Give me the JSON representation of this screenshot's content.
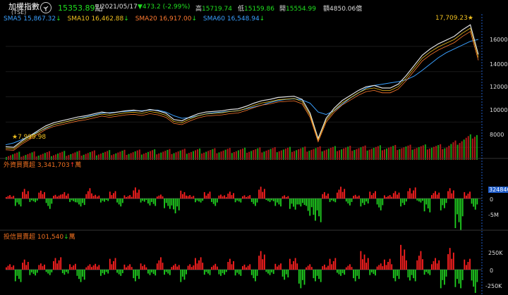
{
  "header": {
    "index_name": "加權指數",
    "index_code": "(TSE)",
    "price": "15353.89",
    "price_unit": "點",
    "date": "2021/05/17",
    "change": "473.2",
    "change_pct": "(-2.99%)",
    "high_label": "高",
    "high": "15719.74",
    "low_label": "低",
    "low": "15159.86",
    "open_label": "開",
    "open": "15554.99",
    "volume_label": "額",
    "volume": "4850.06億"
  },
  "ma_legend": [
    {
      "label": "SMA5",
      "value": "15,867.32",
      "dir": "↓",
      "color": "#c8c8c8"
    },
    {
      "label": "SMA10",
      "value": "16,462.88",
      "dir": "↓",
      "color": "#f0c020"
    },
    {
      "label": "SMA20",
      "value": "16,917.00",
      "dir": "↓",
      "color": "#ff7a30"
    },
    {
      "label": "SMA60",
      "value": "16,548.94",
      "dir": "↓",
      "color": "#3aa0ff"
    }
  ],
  "annotations": {
    "high_mark": "17,709.23",
    "low_mark": "7,999.98"
  },
  "foreign_panel": {
    "title": "外資買賣超",
    "value": "3,341,703",
    "dir": "↑",
    "unit": "萬",
    "tag": "32484C"
  },
  "trust_panel": {
    "title": "投信買賣超",
    "value": "101,540",
    "dir": "↓",
    "unit": "萬"
  },
  "colors": {
    "up": "#ff2020",
    "down": "#20d020",
    "accent": "#f0c020",
    "ma60": "#3aa0ff"
  },
  "chart_data": [
    {
      "type": "line",
      "ylim": [
        7400,
        18000
      ],
      "yticks": [
        "16000",
        "14000",
        "12000",
        "10000",
        "8000"
      ],
      "series": [
        {
          "name": "SMA60",
          "values": [
            8200,
            8350,
            8600,
            8900,
            9200,
            9500,
            9800,
            9950,
            10100,
            10250,
            10400,
            10550,
            10700,
            10750,
            10800,
            10850,
            10900,
            10900,
            10950,
            10950,
            10800,
            10500,
            10300,
            10350,
            10500,
            10650,
            10750,
            10800,
            10850,
            10900,
            11050,
            11200,
            11350,
            11550,
            11700,
            11800,
            11850,
            11750,
            11500,
            10800,
            10600,
            10900,
            11400,
            11900,
            12300,
            12700,
            12900,
            13000,
            13100,
            13200,
            13350,
            13650,
            14100,
            14600,
            15100,
            15500,
            15800,
            16100,
            16400,
            16550
          ]
        },
        {
          "name": "Close",
          "values": [
            8050,
            7999.98,
            8500,
            8900,
            9300,
            9700,
            9950,
            10100,
            10250,
            10400,
            10500,
            10650,
            10800,
            10700,
            10800,
            10900,
            10950,
            10850,
            11000,
            10900,
            10700,
            10200,
            10100,
            10400,
            10650,
            10800,
            10850,
            10900,
            11000,
            11050,
            11250,
            11500,
            11700,
            11800,
            11950,
            12000,
            12050,
            11800,
            10700,
            8700,
            10300,
            11100,
            11700,
            12100,
            12500,
            12800,
            12900,
            12700,
            12700,
            13000,
            13700,
            14500,
            15300,
            15800,
            16200,
            16500,
            16800,
            17300,
            17709.23,
            15353.89
          ]
        }
      ]
    },
    {
      "type": "bar",
      "series": [
        {
          "name": "外資買賣超",
          "values": [
            1,
            -2,
            3,
            -1,
            2,
            -3,
            1,
            2,
            -1,
            -2,
            3,
            1,
            -1,
            2,
            -2,
            1,
            3,
            -1,
            -2,
            1,
            -3,
            -4,
            2,
            1,
            -1,
            2,
            -2,
            1,
            2,
            -1,
            1,
            -2,
            3,
            -1,
            -2,
            1,
            -3,
            -2,
            -5,
            -6,
            2,
            -1,
            3,
            -2,
            1,
            -2,
            2,
            -3,
            1,
            2,
            -2,
            3,
            -1,
            -4,
            2,
            -3,
            3,
            -8,
            2,
            -3
          ]
        }
      ]
    },
    {
      "type": "bar",
      "series": [
        {
          "name": "投信買賣超",
          "values": [
            1,
            -2,
            2,
            -1,
            1,
            -1,
            2,
            -1,
            1,
            -2,
            1,
            1,
            -1,
            2,
            -1,
            1,
            -2,
            1,
            -1,
            2,
            -1,
            1,
            -2,
            1,
            2,
            -1,
            1,
            -1,
            2,
            -1,
            1,
            -2,
            3,
            -1,
            1,
            -2,
            2,
            -3,
            1,
            -2,
            1,
            2,
            -1,
            1,
            -2,
            3,
            -1,
            1,
            2,
            -2,
            4,
            -2,
            3,
            -1,
            2,
            -3,
            4,
            -3,
            2,
            -4
          ]
        }
      ]
    }
  ]
}
